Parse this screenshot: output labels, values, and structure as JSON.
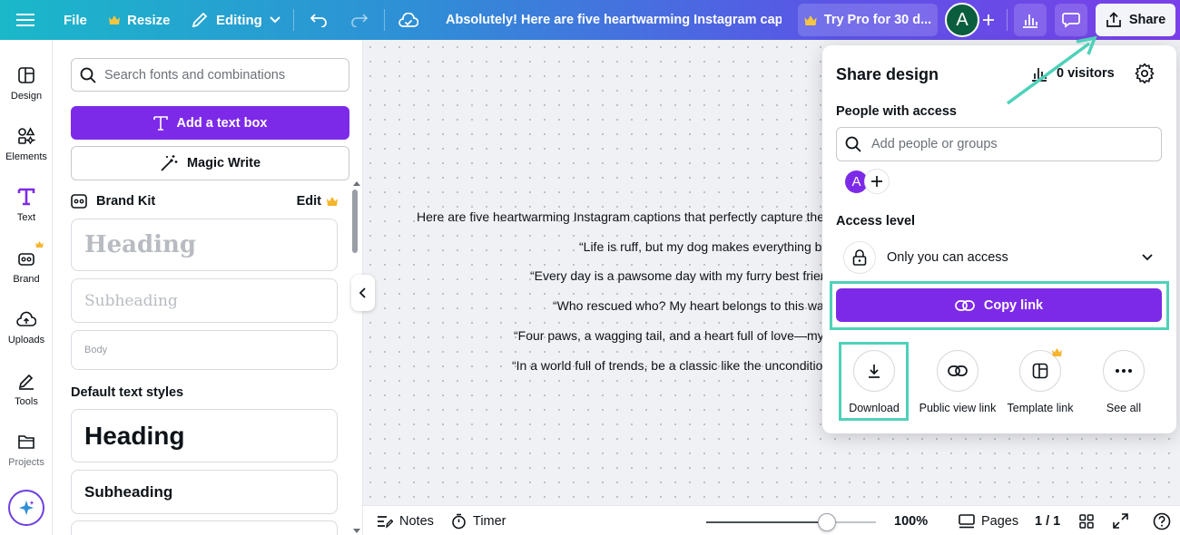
{
  "topbar": {
    "file": "File",
    "resize": "Resize",
    "editing": "Editing",
    "doc_title": "Absolutely! Here are five heartwarming Instagram captio...",
    "try_pro": "Try Pro for 30 d...",
    "avatar_letter": "A",
    "share": "Share"
  },
  "rail": [
    {
      "label": "Design",
      "icon": "design-icon"
    },
    {
      "label": "Elements",
      "icon": "elements-icon"
    },
    {
      "label": "Text",
      "icon": "text-icon"
    },
    {
      "label": "Brand",
      "icon": "brand-icon"
    },
    {
      "label": "Uploads",
      "icon": "uploads-icon"
    },
    {
      "label": "Tools",
      "icon": "tools-icon"
    },
    {
      "label": "Projects",
      "icon": "projects-icon"
    }
  ],
  "panel": {
    "search_placeholder": "Search fonts and combinations",
    "add_text_box": "Add a text box",
    "magic_write": "Magic Write",
    "brand_kit": "Brand Kit",
    "edit": "Edit",
    "brand_heading": "Heading",
    "brand_subheading": "Subheading",
    "brand_body": "Body",
    "default_styles_title": "Default text styles",
    "default_heading": "Heading",
    "default_subheading": "Subheading"
  },
  "canvas": {
    "lines": [
      "Here are five heartwarming Instagram captions that perfectly capture the l",
      "“Life is ruff, but my dog makes everything be",
      "“Every day is a pawsome day with my furry best frien",
      "“Who rescued who? My heart belongs to this wag",
      "“Four paws, a wagging tail, and a heart full of love—my d",
      "“In a world full of trends, be a classic like the uncondition"
    ]
  },
  "share_panel": {
    "title": "Share design",
    "visitors": "0 visitors",
    "people_label": "People with access",
    "add_placeholder": "Add people or groups",
    "avatar_letter": "A",
    "access_label": "Access level",
    "access_value": "Only you can access",
    "copy_link": "Copy link",
    "options": [
      {
        "label": "Download",
        "icon": "download-icon"
      },
      {
        "label": "Public view link",
        "icon": "link-icon"
      },
      {
        "label": "Template link",
        "icon": "template-icon"
      },
      {
        "label": "See all",
        "icon": "more-icon"
      }
    ]
  },
  "bottombar": {
    "notes": "Notes",
    "timer": "Timer",
    "zoom": "100%",
    "zoom_level": 0.71,
    "pages": "Pages",
    "page_count": "1 / 1"
  },
  "colors": {
    "accent_purple": "#7d2ae8",
    "highlight_teal": "#4fd1b9"
  }
}
